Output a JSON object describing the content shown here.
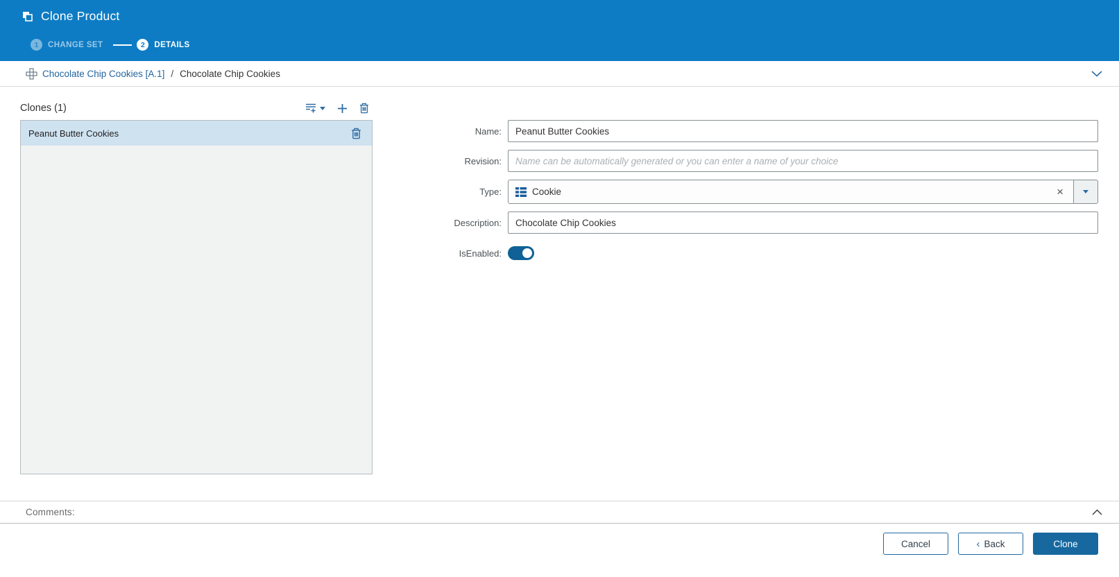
{
  "header": {
    "title": "Clone Product",
    "steps": [
      {
        "number": "1",
        "label": "CHANGE SET"
      },
      {
        "number": "2",
        "label": "DETAILS"
      }
    ]
  },
  "breadcrumb": {
    "link": "Chocolate Chip Cookies [A.1]",
    "separator": "/",
    "current": "Chocolate Chip Cookies"
  },
  "clones_panel": {
    "title": "Clones (1)",
    "items": [
      {
        "name": "Peanut Butter Cookies"
      }
    ]
  },
  "form": {
    "name": {
      "label": "Name:",
      "value": "Peanut Butter Cookies"
    },
    "revision": {
      "label": "Revision:",
      "value": "",
      "placeholder": "Name can be automatically generated or you can enter a name of your choice"
    },
    "type": {
      "label": "Type:",
      "value": "Cookie"
    },
    "description": {
      "label": "Description:",
      "value": "Chocolate Chip Cookies"
    },
    "is_enabled": {
      "label": "IsEnabled:",
      "on": true
    }
  },
  "comments": {
    "label": "Comments:"
  },
  "footer": {
    "cancel_label": "Cancel",
    "back_chevron": "‹",
    "back_label": "Back",
    "clone_label": "Clone"
  },
  "glyphs": {
    "clear_x": "×"
  },
  "colors": {
    "header_blue": "#0d7cc4",
    "icon_blue": "#2e6da4",
    "link_blue": "#24659e",
    "selected_row": "#cfe2f0",
    "primary_button": "#16689f",
    "toggle_on": "#0f6196",
    "type_icon_blue": "#1a5c9e"
  }
}
